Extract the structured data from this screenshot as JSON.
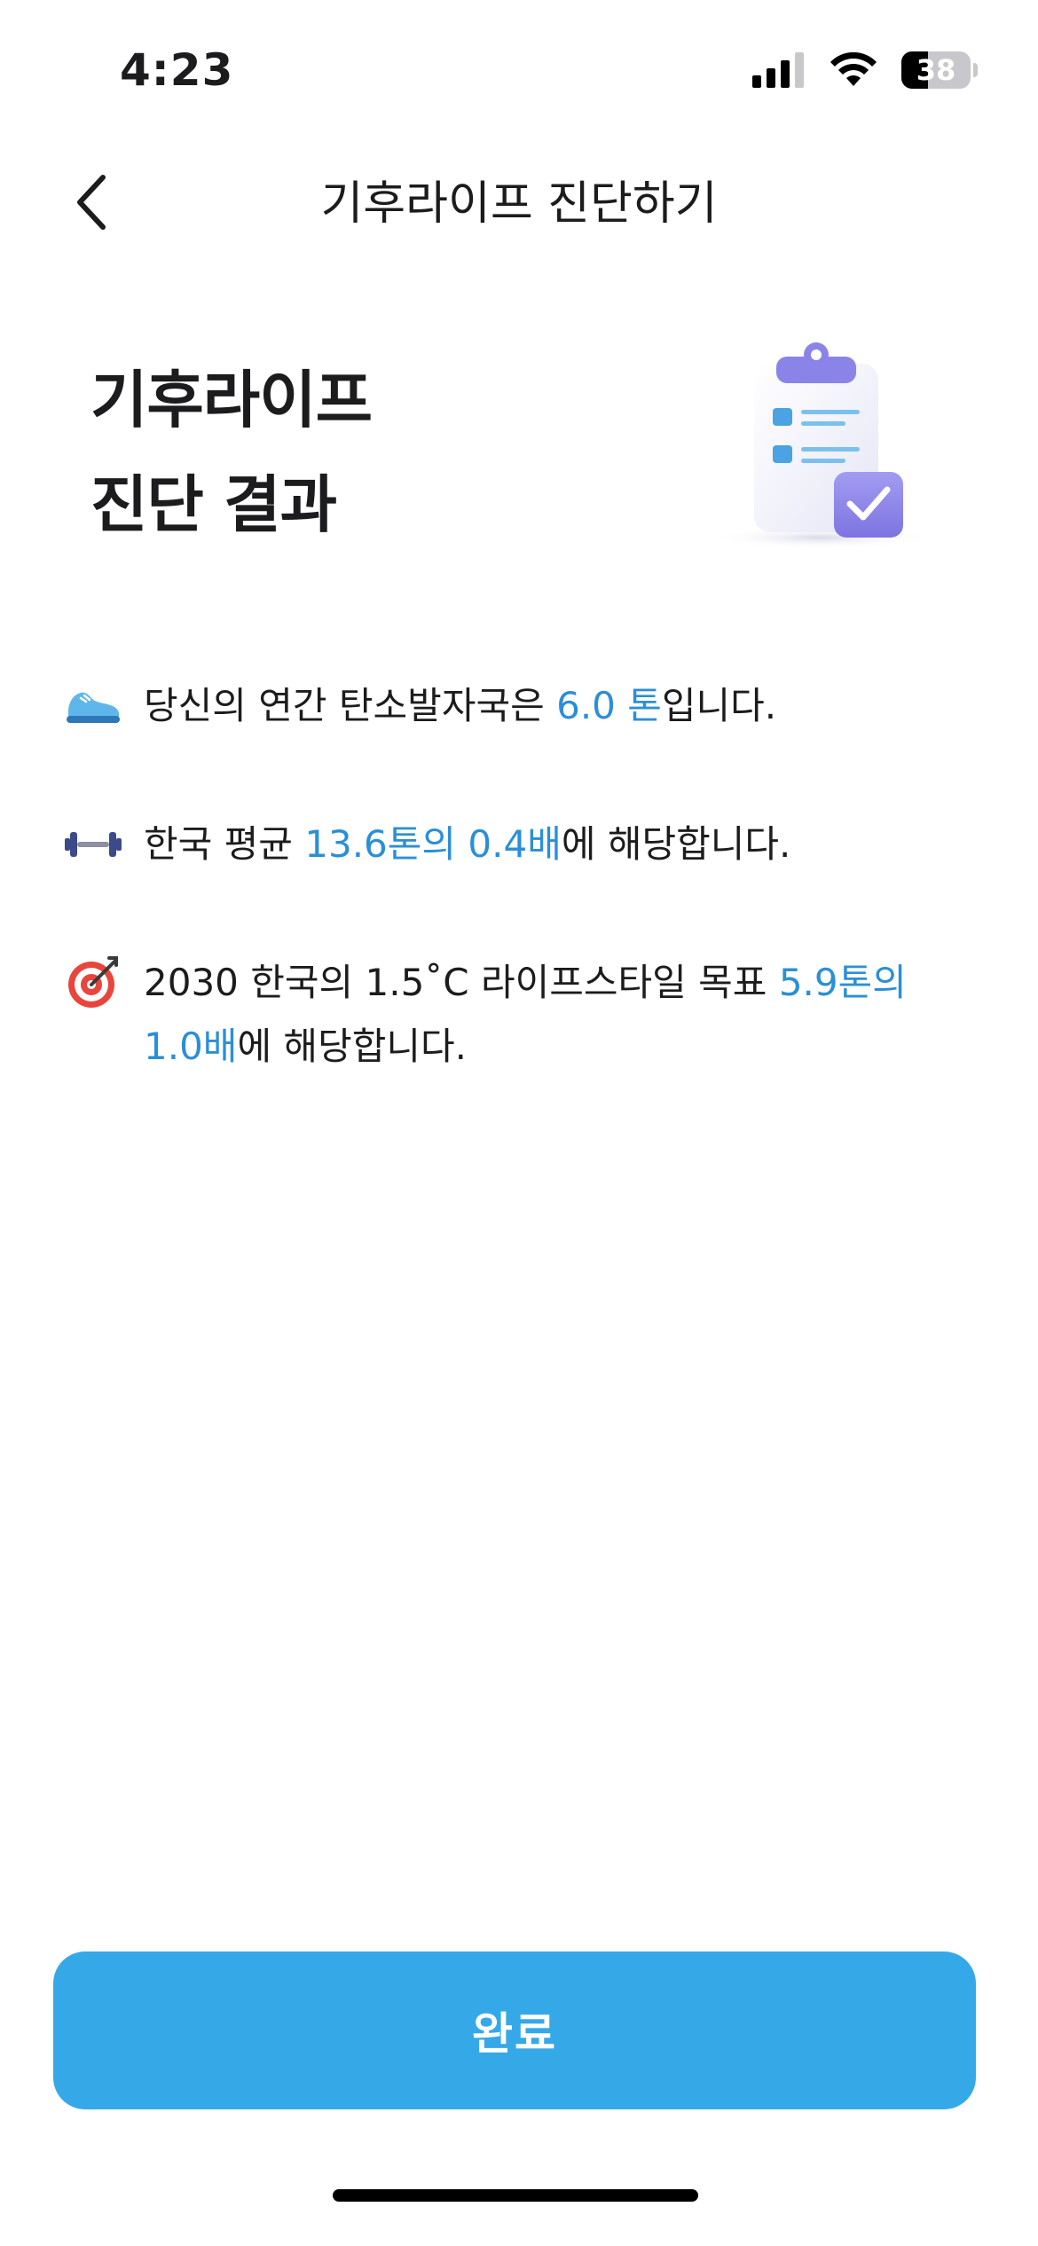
{
  "status_bar": {
    "time": "4:23",
    "battery_level": "38",
    "battery_fraction": 0.38
  },
  "nav": {
    "title": "기후라이프 진단하기",
    "back_icon": "chevron-left-icon"
  },
  "header": {
    "headline": "기후라이프\n진단 결과",
    "illustration_icon": "clipboard-check-icon"
  },
  "results": [
    {
      "icon": "sneaker-icon",
      "prefix": "당신의 연간 탄소발자국은 ",
      "highlight": "6.0 톤",
      "suffix": "입니다."
    },
    {
      "icon": "dumbbell-icon",
      "prefix": "한국 평균 ",
      "highlight": "13.6톤의 0.4배",
      "suffix": "에 해당합니다."
    },
    {
      "icon": "target-icon",
      "prefix": "2030 한국의 1.5˚C 라이프스타일 목표 ",
      "highlight": "5.9톤의 1.0배",
      "suffix": "에 해당합니다."
    }
  ],
  "footer": {
    "complete_label": "완료"
  },
  "colors": {
    "accent": "#35a8e8",
    "highlight_text": "#2b8fd6",
    "illustration_purple": "#8b84e8"
  }
}
